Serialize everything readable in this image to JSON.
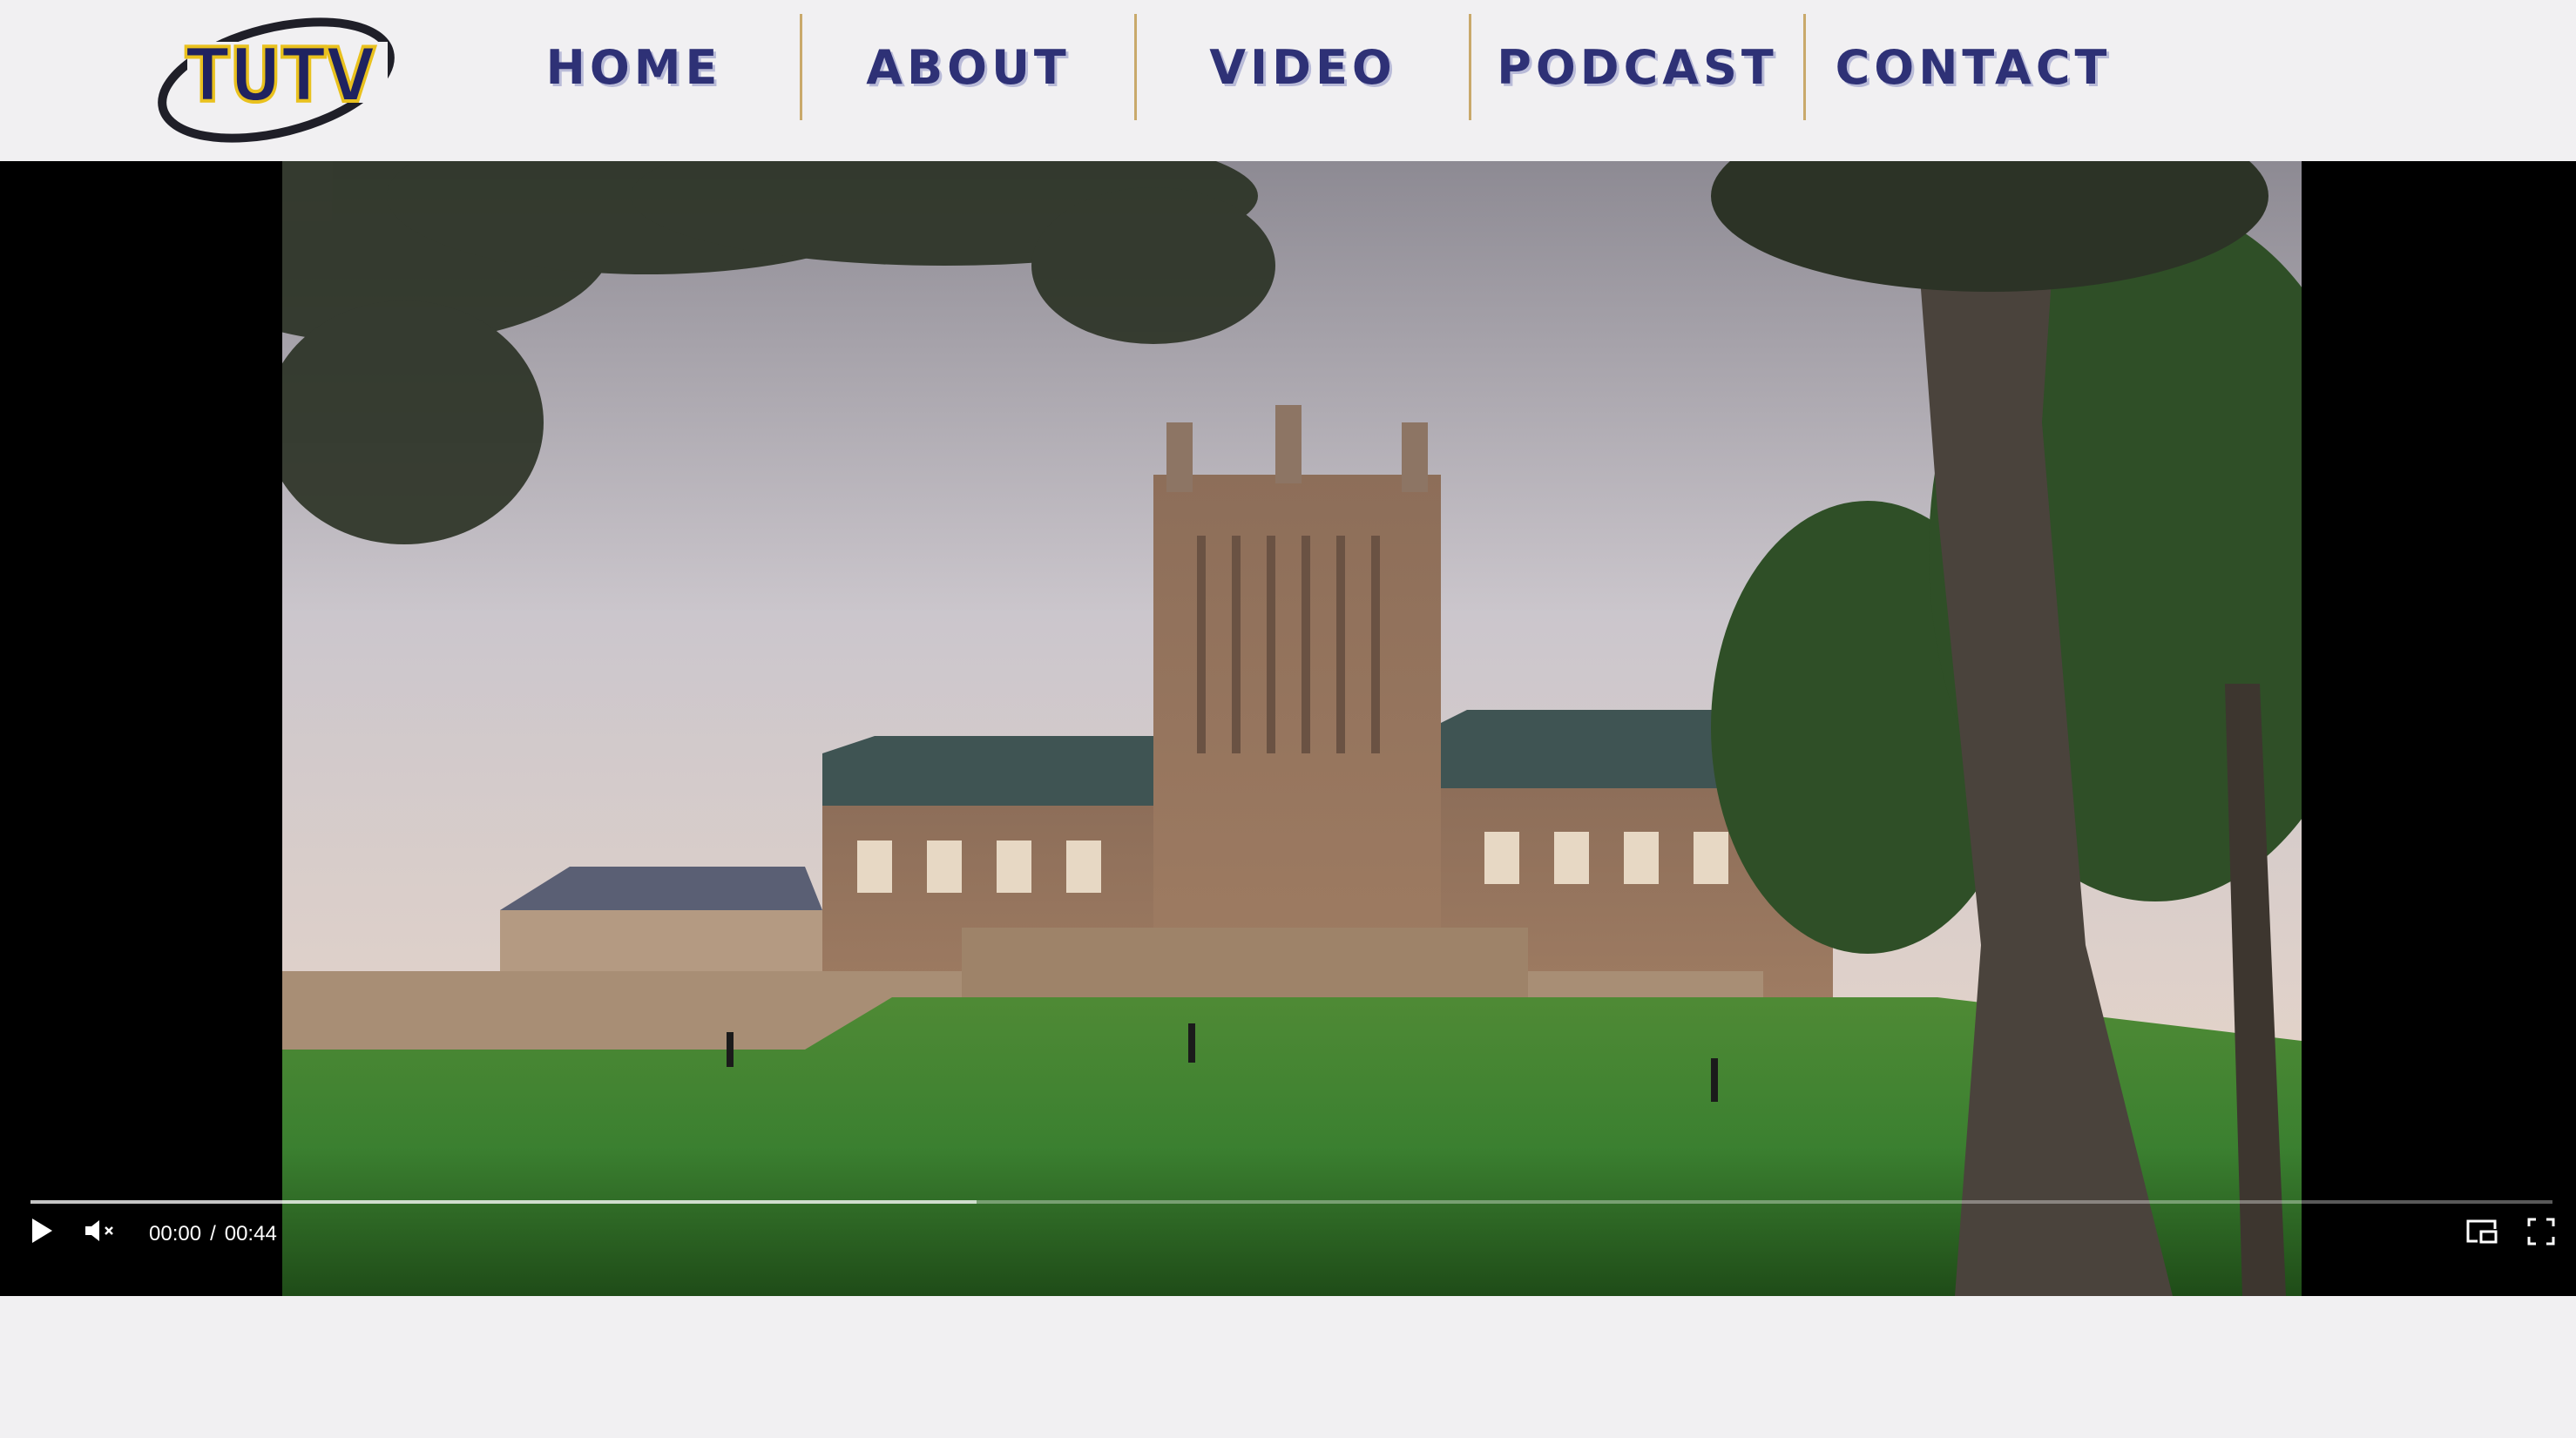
{
  "site": {
    "logo_text": "TUTV",
    "colors": {
      "navy": "#2e3176",
      "gold": "#e9c11e",
      "divider": "#c9a96b",
      "background": "#f1f0f2"
    }
  },
  "nav": {
    "items": [
      {
        "label": "HOME"
      },
      {
        "label": "ABOUT"
      },
      {
        "label": "VIDEO"
      },
      {
        "label": "PODCAST"
      },
      {
        "label": "CONTACT"
      }
    ]
  },
  "player": {
    "current_time": "00:00",
    "separator": "/",
    "duration": "00:44",
    "played_fraction": 0.0,
    "buffered_fraction": 0.375,
    "muted": true,
    "icons": {
      "play": "play-icon",
      "mute": "volume-muted-icon",
      "pip": "picture-in-picture-icon",
      "fullscreen": "fullscreen-icon"
    }
  }
}
